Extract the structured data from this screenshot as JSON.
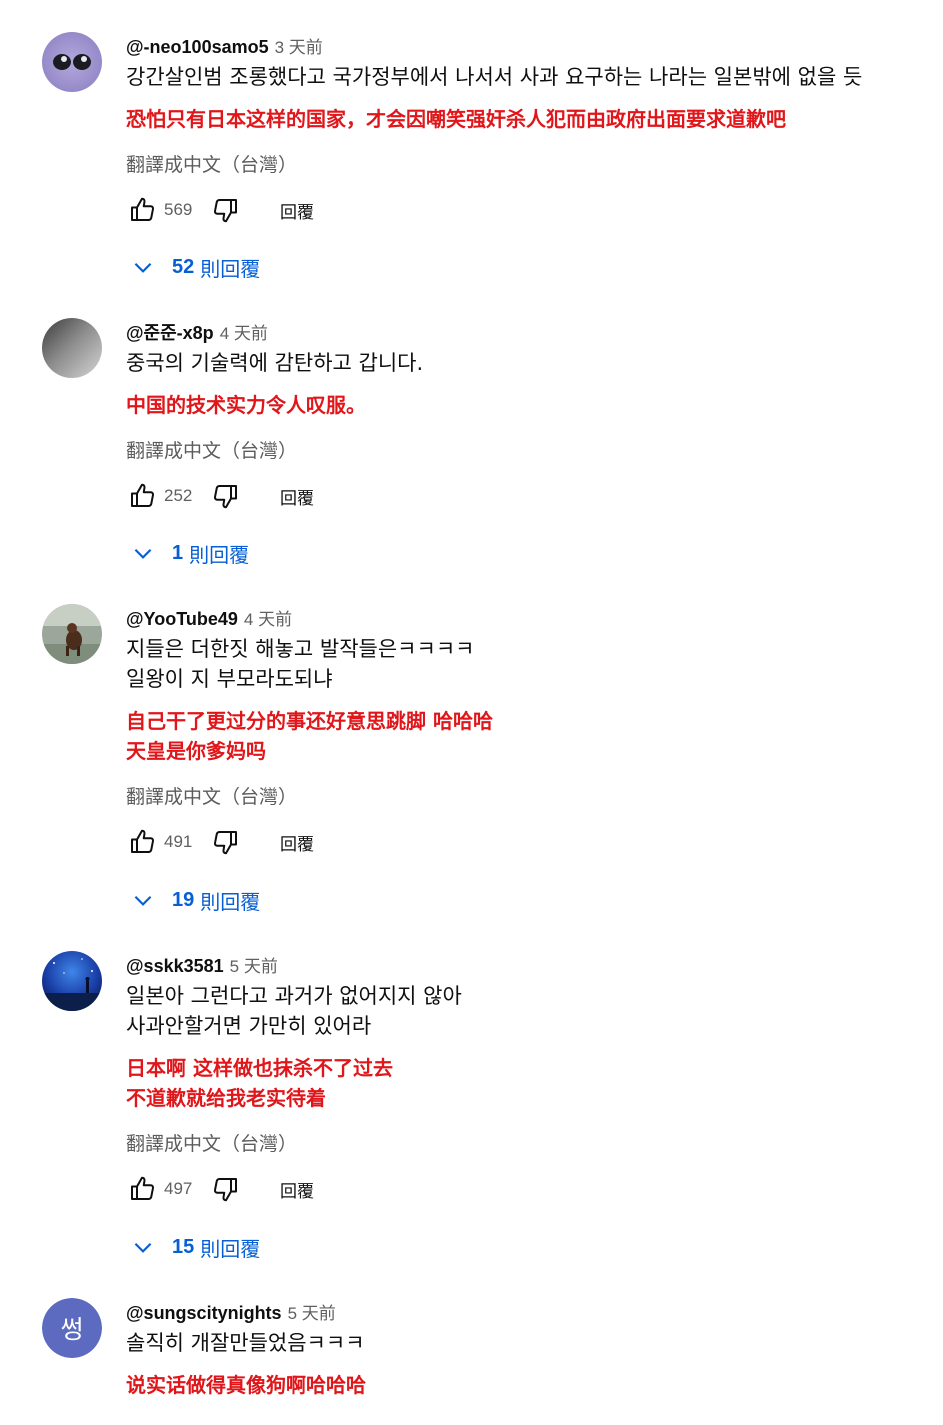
{
  "translate_label": "翻譯成中文（台灣）",
  "reply_label": "回覆",
  "replies_suffix": "則回覆",
  "comments": [
    {
      "author": "@-neo100samo5",
      "time": "3 天前",
      "text": [
        "강간살인범 조롱했다고 국가정부에서 나서서 사과 요구하는 나라는 일본밖에 없을 듯"
      ],
      "translation": [
        "恐怕只有日本这样的国家，才会因嘲笑强奸杀人犯而由政府出面要求道歉吧"
      ],
      "likes": "569",
      "replies": "52",
      "avatar": "purple-eyes"
    },
    {
      "author": "@준준-x8p",
      "time": "4 天前",
      "text": [
        "중국의 기술력에 감탄하고 갑니다."
      ],
      "translation": [
        "中国的技术实力令人叹服。"
      ],
      "likes": "252",
      "replies": "1",
      "avatar": "grey-gradient"
    },
    {
      "author": "@YooTube49",
      "time": "4 天前",
      "text": [
        "지들은 더한짓 해놓고 발작들은ㅋㅋㅋㅋ",
        "일왕이 지 부모라도되냐"
      ],
      "translation": [
        "自己干了更过分的事还好意思跳脚 哈哈哈",
        "天皇是你爹妈吗"
      ],
      "likes": "491",
      "replies": "19",
      "avatar": "dog-photo"
    },
    {
      "author": "@sskk3581",
      "time": "5 天前",
      "text": [
        "일본아 그런다고 과거가 없어지지 않아",
        "사과안할거면 가만히 있어라"
      ],
      "translation": [
        "日本啊 这样做也抹杀不了过去",
        "不道歉就给我老实待着"
      ],
      "likes": "497",
      "replies": "15",
      "avatar": "night-sky"
    },
    {
      "author": "@sungscitynights",
      "time": "5 天前",
      "text": [
        "솔직히 개잘만들었음ㅋㅋㅋ"
      ],
      "translation": [
        "说实话做得真像狗啊哈哈哈"
      ],
      "avatar": "letter",
      "avatar_letter": "썽",
      "avatar_color": "#5c6bc0"
    }
  ],
  "colors": {
    "translation": "#e0161a",
    "link_blue": "#065fd4",
    "meta_grey": "#606060"
  }
}
